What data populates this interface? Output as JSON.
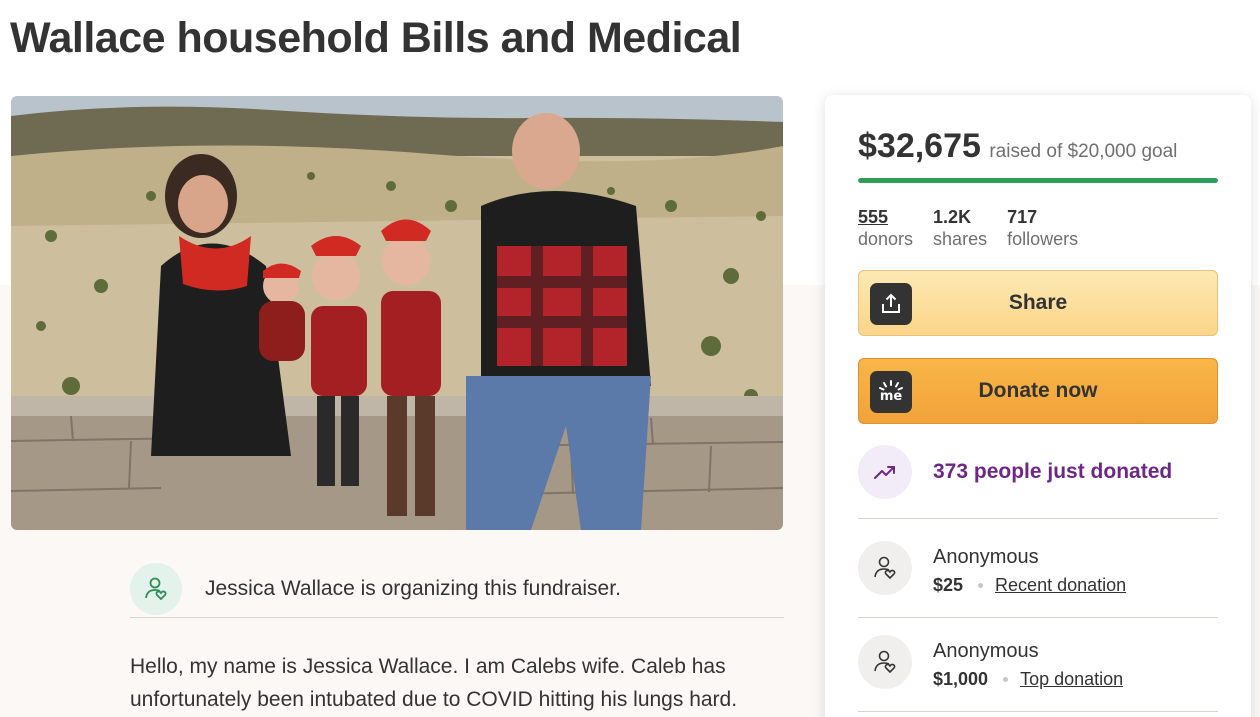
{
  "page": {
    "title": "Wallace household Bills and Medical"
  },
  "hero": {
    "alt_description": ""
  },
  "organizer": {
    "text": "Jessica Wallace is organizing this fundraiser.",
    "icon": "person-heart-icon"
  },
  "story": {
    "text": "Hello, my name is Jessica Wallace. I am Calebs wife. Caleb has unfortunately been intubated due to COVID hitting his lungs hard."
  },
  "card": {
    "raised": "$32,675",
    "goal_text": "raised of $20,000 goal",
    "progress_fraction": 1.0,
    "progress_color": "#2f9c59",
    "stats": [
      {
        "value": "555",
        "label": "donors"
      },
      {
        "value": "1.2K",
        "label": "shares"
      },
      {
        "value": "717",
        "label": "followers"
      }
    ],
    "share_label": "Share",
    "donate_label": "Donate now",
    "donate_icon_text": "me",
    "trend_text": "373 people just donated",
    "trend_color": "#6e2787",
    "donations": [
      {
        "name": "Anonymous",
        "amount": "$25",
        "tag": "Recent donation"
      },
      {
        "name": "Anonymous",
        "amount": "$1,000",
        "tag": "Top donation"
      }
    ]
  }
}
